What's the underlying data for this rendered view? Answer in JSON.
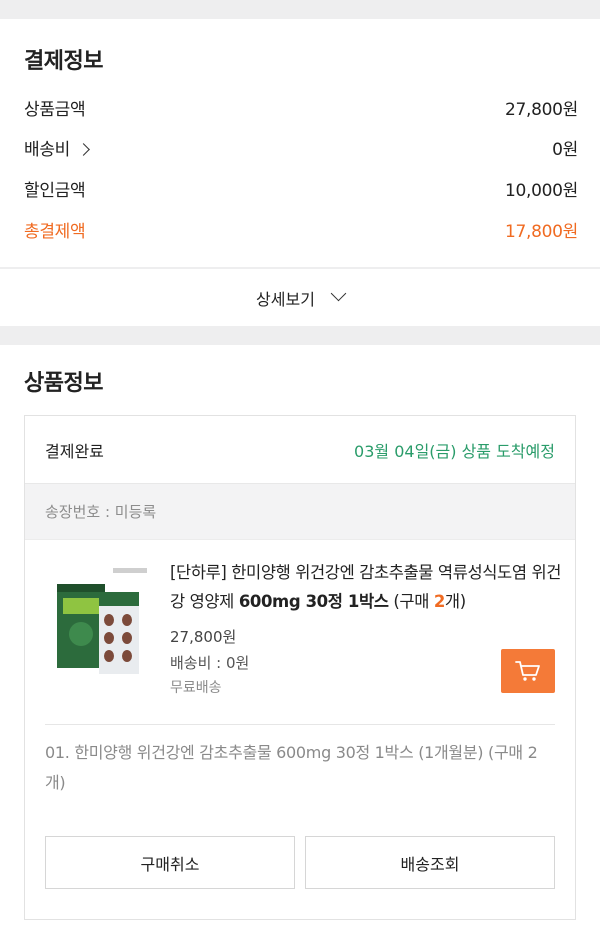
{
  "payment": {
    "title": "결제정보",
    "rows": [
      {
        "label": "상품금액",
        "value": "27,800원"
      },
      {
        "label": "배송비",
        "value": "0원"
      },
      {
        "label": "할인금액",
        "value": "10,000원"
      },
      {
        "label": "총결제액",
        "value": "17,800원"
      }
    ],
    "detail_label": "상세보기"
  },
  "product": {
    "title": "상품정보",
    "status": "결제완료",
    "arrival": "03월 04일(금) 상품 도착예정",
    "tracking": "송장번호 : 미등록",
    "name_prefix": "[단하루] 한미양행 위건강엔 감초추출물 역류성식도염 위건강 영양제 ",
    "name_bold": "600mg 30정 1박스",
    "name_paren_open": " (구매 ",
    "name_qty": "2",
    "name_paren_close": "개)",
    "price": "27,800원",
    "shipping": "배송비 : 0원",
    "free_shipping": "무료배송",
    "option": "01. 한미양행 위건강엔 감초추출물 600mg 30정 1박스 (1개월분) (구매 2개)",
    "cancel_label": "구매취소",
    "track_label": "배송조회"
  },
  "colors": {
    "accent": "#f06b22",
    "cart_button": "#f47a38",
    "arrival_green": "#2a9c6a"
  },
  "icons": {
    "shipping_fee_chevron": "chevron-right-icon",
    "detail_chevron": "chevron-down-icon",
    "cart": "cart-icon"
  }
}
